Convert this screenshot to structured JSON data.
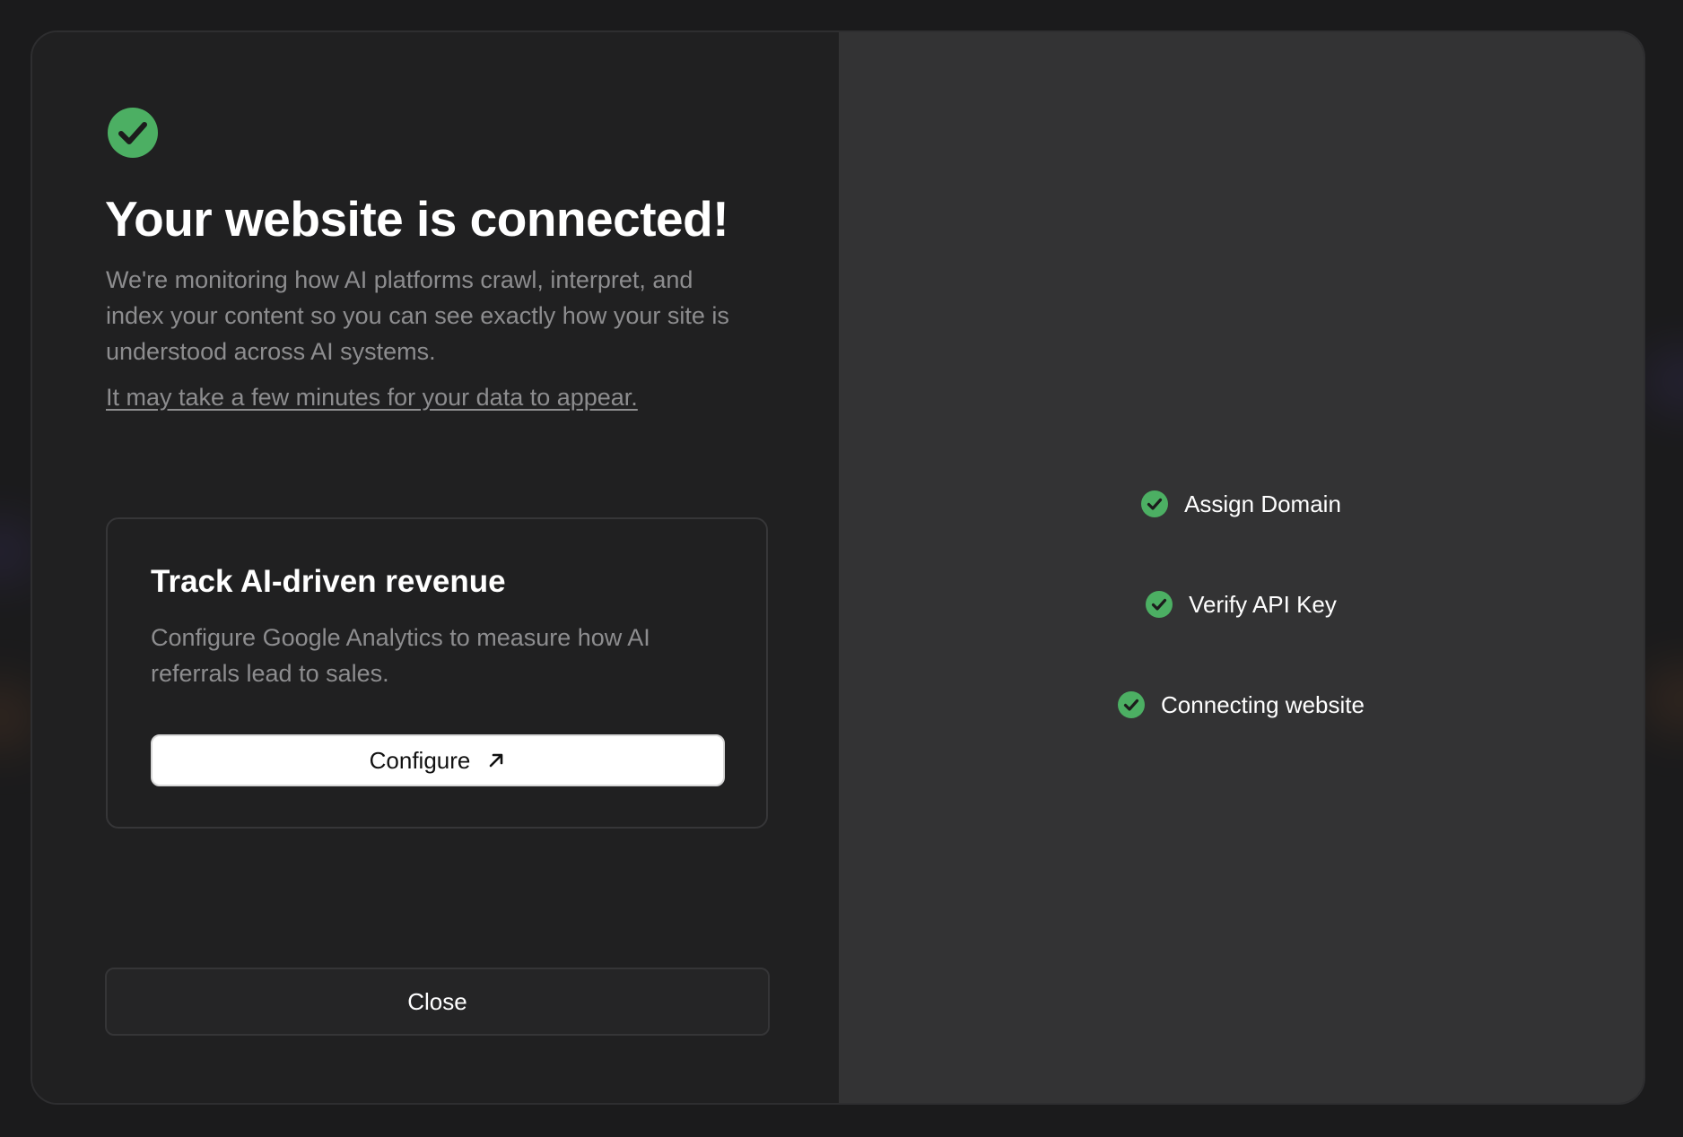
{
  "theme": {
    "success_color": "#4caf63",
    "background": "#1b1b1c",
    "left_panel": "#202021",
    "right_panel": "#333334"
  },
  "header": {
    "icon": "check-circle-icon",
    "title": "Your website is connected!",
    "description": "We're monitoring how AI platforms crawl, interpret, and index your content so you can see exactly how your site is understood across AI systems.",
    "note": "It may take a few minutes for your data to appear."
  },
  "card": {
    "title": "Track AI-driven revenue",
    "description": "Configure Google Analytics to measure how AI referrals lead to sales.",
    "button_label": "Configure",
    "button_icon": "arrow-up-right-icon"
  },
  "footer": {
    "close_label": "Close"
  },
  "steps": [
    {
      "label": "Assign Domain",
      "status": "complete",
      "icon": "check-circle-icon"
    },
    {
      "label": "Verify API Key",
      "status": "complete",
      "icon": "check-circle-icon"
    },
    {
      "label": "Connecting website",
      "status": "complete",
      "icon": "check-circle-icon"
    }
  ]
}
